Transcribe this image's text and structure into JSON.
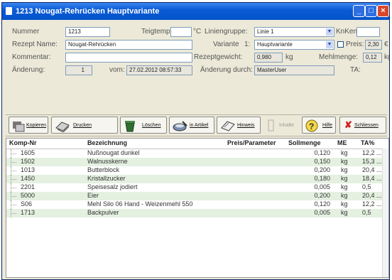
{
  "window": {
    "title": "1213 Nougat-Rehrücken Hauptvariante"
  },
  "form": {
    "nummer_label": "Nummer",
    "nummer_value": "1213",
    "teigtemp_label": "Teigtemp:",
    "teigtemp_value": "",
    "teigtemp_unit": "°C",
    "liniengruppe_label": "Liniengruppe:",
    "liniengruppe_value": "Linie 1",
    "knkennl_label": "KnKennl:",
    "knkennl_value": "",
    "rezeptname_label": "Rezept Name:",
    "rezeptname_value": "Nougat-Rehrücken",
    "variante_label": "Variante",
    "variante_num": "1:",
    "variante_value": "Hauptvariante",
    "preis_label": "Preis:",
    "preis_value": "2,30",
    "preis_unit": "€",
    "kommentar_label": "Kommentar:",
    "kommentar_value": "",
    "rezeptgewicht_label": "Rezeptgewicht:",
    "rezeptgewicht_value": "0,980",
    "rezeptgewicht_unit": "kg",
    "mehlmenge_label": "Mehlmenge:",
    "mehlmenge_value": "0,12",
    "mehlmenge_unit": "kg",
    "aenderung_label": "Änderung:",
    "aenderung_value": "1",
    "vom_label": "vom:",
    "vom_value": "27.02.2012 08:57:33",
    "aenderung_durch_label": "Änderung durch:",
    "aenderung_durch_value": "MasterUser",
    "ta_label": "TA:",
    "ta_value": ""
  },
  "toolbar": {
    "kopieren": "Kopieren",
    "drucken": "Drucken",
    "loeschen": "Löschen",
    "in_artikel": "in Artikel",
    "hinweis": "Hinweis",
    "inhalte": "Inhalte",
    "hilfe": "Hilfe",
    "schliessen": "Schliessen"
  },
  "grid": {
    "headers": {
      "komp_nr": "Komp-Nr",
      "bezeichnung": "Bezeichnung",
      "preis_parameter": "Preis/Parameter",
      "sollmenge": "Sollmenge",
      "me": "ME",
      "ta": "TA%"
    },
    "rows": [
      {
        "komp_nr": "1605",
        "bezeichnung": "Nußnougat dunkel",
        "sollmenge": "0,120",
        "me": "kg",
        "ta": "12,2 ..."
      },
      {
        "komp_nr": "1502",
        "bezeichnung": "Walnusskerne",
        "sollmenge": "0,150",
        "me": "kg",
        "ta": "15,3 ..."
      },
      {
        "komp_nr": "1013",
        "bezeichnung": "Butterblock",
        "sollmenge": "0,200",
        "me": "kg",
        "ta": "20,4 ..."
      },
      {
        "komp_nr": "1450",
        "bezeichnung": "Kristallzucker",
        "sollmenge": "0,180",
        "me": "kg",
        "ta": "18,4 ..."
      },
      {
        "komp_nr": "2201",
        "bezeichnung": "Speisesalz jodiert",
        "sollmenge": "0,005",
        "me": "kg",
        "ta": "0,5"
      },
      {
        "komp_nr": "5000",
        "bezeichnung": "Eier",
        "sollmenge": "0,200",
        "me": "kg",
        "ta": "20,4 ..."
      },
      {
        "komp_nr": "S06",
        "bezeichnung": "Mehl Silo 06 Hand - Weizenmehl 550",
        "sollmenge": "0,120",
        "me": "kg",
        "ta": "12,2 ..."
      },
      {
        "komp_nr": "1713",
        "bezeichnung": "Backpulver",
        "sollmenge": "0,005",
        "me": "kg",
        "ta": "0,5"
      }
    ]
  }
}
